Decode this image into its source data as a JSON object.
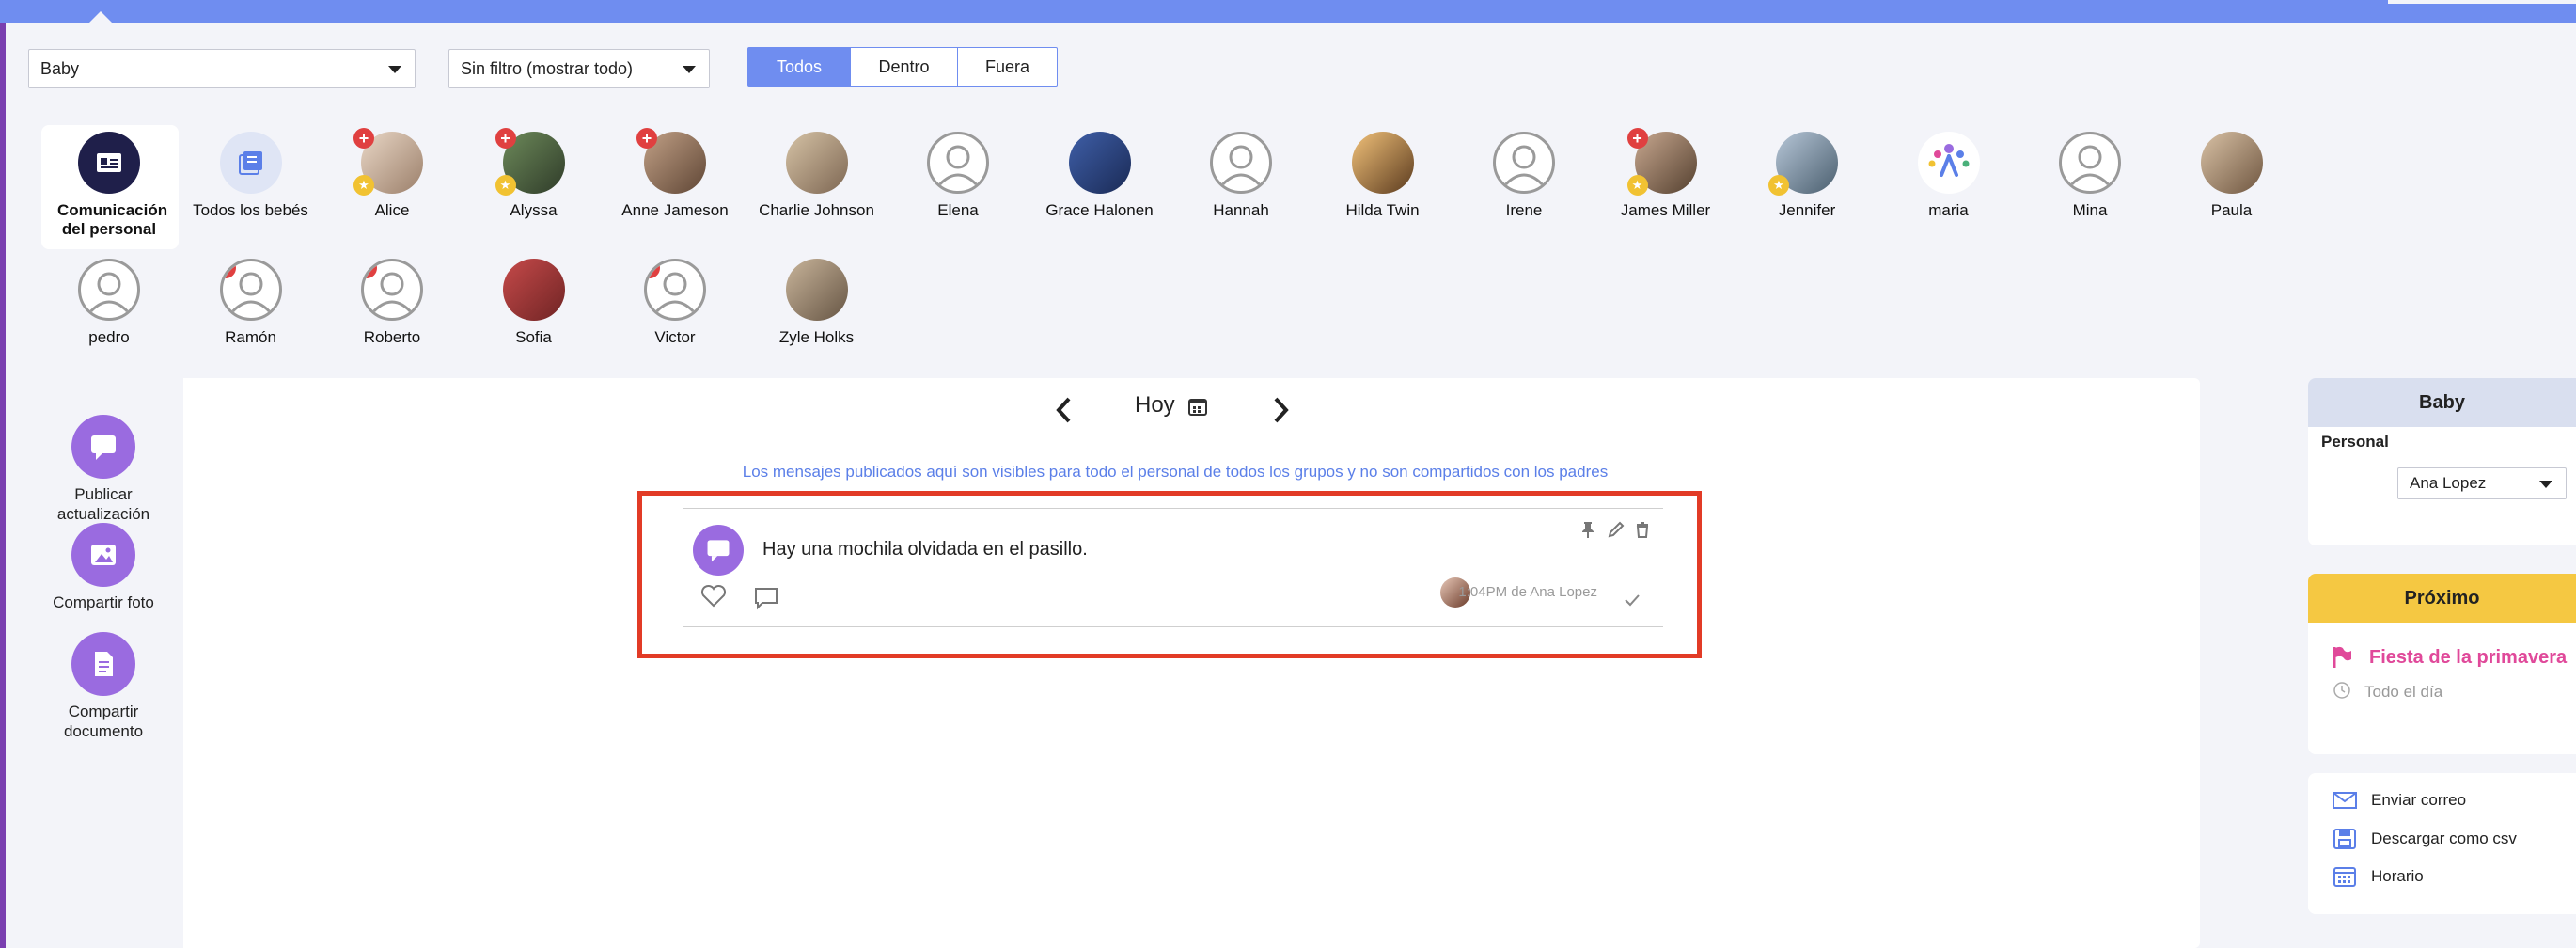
{
  "filters": {
    "group_select": "Baby",
    "filter_select": "Sin filtro (mostrar todo)",
    "segments": [
      "Todos",
      "Dentro",
      "Fuera"
    ],
    "active_segment": "Todos"
  },
  "children": [
    {
      "name": "Comunicación del personal",
      "kind": "staff"
    },
    {
      "name": "Todos los bebés",
      "kind": "all"
    },
    {
      "name": "Alice",
      "kind": "photo",
      "red": true,
      "yellow": true
    },
    {
      "name": "Alyssa",
      "kind": "photo",
      "red": true,
      "yellow": true
    },
    {
      "name": "Anne Jameson",
      "kind": "photo",
      "red": true
    },
    {
      "name": "Charlie Johnson",
      "kind": "photo"
    },
    {
      "name": "Elena",
      "kind": "empty"
    },
    {
      "name": "Grace Halonen",
      "kind": "photo"
    },
    {
      "name": "Hannah",
      "kind": "empty"
    },
    {
      "name": "Hilda Twin",
      "kind": "photo"
    },
    {
      "name": "Irene",
      "kind": "empty"
    },
    {
      "name": "James Miller",
      "kind": "photo",
      "red": true,
      "yellow": true
    },
    {
      "name": "Jennifer",
      "kind": "photo",
      "yellow": true
    },
    {
      "name": "maria",
      "kind": "logo"
    },
    {
      "name": "Mina",
      "kind": "empty"
    },
    {
      "name": "Paula",
      "kind": "photo"
    },
    {
      "name": "pedro",
      "kind": "empty"
    },
    {
      "name": "Ramón",
      "kind": "empty",
      "red": true
    },
    {
      "name": "Roberto",
      "kind": "empty",
      "red": true
    },
    {
      "name": "Sofia",
      "kind": "photo"
    },
    {
      "name": "Victor",
      "kind": "empty",
      "red": true
    },
    {
      "name": "Zyle Holks",
      "kind": "photo"
    }
  ],
  "actions": {
    "publish": "Publicar actualización",
    "photo": "Compartir foto",
    "document": "Compartir documento"
  },
  "date_nav": {
    "label": "Hoy"
  },
  "notice": "Los mensajes publicados aquí son visibles para todo el personal de todos los grupos y no son compartidos con los padres",
  "post": {
    "text": "Hay una mochila olvidada en el pasillo.",
    "meta": "1:04PM de Ana Lopez"
  },
  "right": {
    "group_title": "Baby",
    "staff_label": "Personal",
    "staff_select": "Ana Lopez",
    "upcoming_title": "Próximo",
    "event_title": "Fiesta de la primavera",
    "event_time": "Todo el día",
    "links": [
      "Enviar correo",
      "Descargar como csv",
      "Horario"
    ]
  },
  "colors": {
    "accent": "#6f8df0",
    "purple": "#9a6be0",
    "upcoming": "#f5c842",
    "event": "#e0499a",
    "highlight": "#e23b26"
  }
}
